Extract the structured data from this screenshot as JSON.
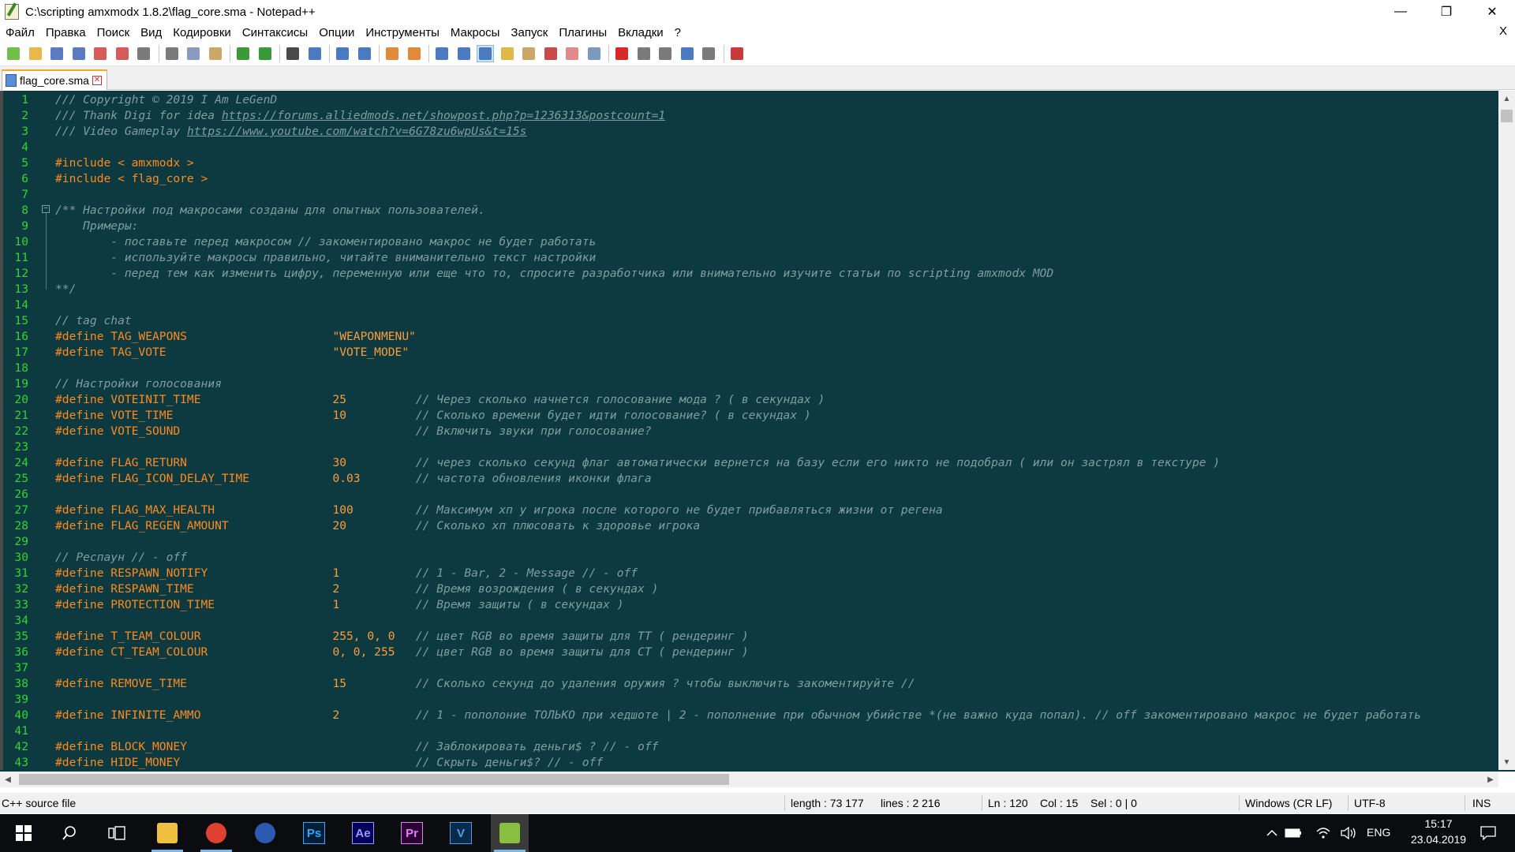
{
  "window": {
    "title": "C:\\scripting amxmodx 1.8.2\\flag_core.sma - Notepad++",
    "controls": {
      "minimize": "—",
      "maximize": "❐",
      "close": "✕"
    }
  },
  "menu": {
    "items": [
      "Файл",
      "Правка",
      "Поиск",
      "Вид",
      "Кодировки",
      "Синтаксисы",
      "Опции",
      "Инструменты",
      "Макросы",
      "Запуск",
      "Плагины",
      "Вкладки",
      "?"
    ],
    "close_doc": "X"
  },
  "toolbar": {
    "buttons": [
      {
        "icon": "new-file-icon",
        "color": "#6fbf4a"
      },
      {
        "icon": "open-file-icon",
        "color": "#e8b84a"
      },
      {
        "icon": "save-icon",
        "color": "#5a7bbf"
      },
      {
        "icon": "save-all-icon",
        "color": "#5a7bbf"
      },
      {
        "icon": "close-file-icon",
        "color": "#d65c5c"
      },
      {
        "icon": "close-all-icon",
        "color": "#d65c5c"
      },
      {
        "icon": "print-icon",
        "color": "#7a7a7a"
      },
      {
        "sep": true
      },
      {
        "icon": "cut-icon",
        "color": "#7a7a7a"
      },
      {
        "icon": "copy-icon",
        "color": "#8a9bbf"
      },
      {
        "icon": "paste-icon",
        "color": "#c9a86a"
      },
      {
        "sep": true
      },
      {
        "icon": "undo-icon",
        "color": "#3a9a3a"
      },
      {
        "icon": "redo-icon",
        "color": "#3a9a3a"
      },
      {
        "sep": true
      },
      {
        "icon": "find-icon",
        "color": "#4a4a4a"
      },
      {
        "icon": "replace-icon",
        "color": "#4a7abf"
      },
      {
        "sep": true
      },
      {
        "icon": "zoom-in-icon",
        "color": "#4a7abf"
      },
      {
        "icon": "zoom-out-icon",
        "color": "#4a7abf"
      },
      {
        "sep": true
      },
      {
        "icon": "sync-vertical-icon",
        "color": "#e08a3a"
      },
      {
        "icon": "sync-horizontal-icon",
        "color": "#e08a3a"
      },
      {
        "sep": true
      },
      {
        "icon": "word-wrap-icon",
        "color": "#4a7abf"
      },
      {
        "icon": "show-all-chars-icon",
        "color": "#4a7abf"
      },
      {
        "icon": "indent-guide-icon",
        "color": "#4a7abf",
        "active": true
      },
      {
        "icon": "udl-icon",
        "color": "#e0b84a"
      },
      {
        "icon": "doc-map-icon",
        "color": "#c9a86a"
      },
      {
        "icon": "function-list-icon",
        "color": "#c94a4a"
      },
      {
        "icon": "folder-as-workspace-icon",
        "color": "#e08a8a"
      },
      {
        "icon": "monitoring-icon",
        "color": "#7a9abf"
      },
      {
        "sep": true
      },
      {
        "icon": "record-macro-icon",
        "color": "#d62a2a"
      },
      {
        "icon": "stop-record-icon",
        "color": "#7a7a7a"
      },
      {
        "icon": "play-macro-icon",
        "color": "#7a7a7a"
      },
      {
        "icon": "run-macro-multiple-icon",
        "color": "#4a7abf"
      },
      {
        "icon": "save-macro-icon",
        "color": "#7a7a7a"
      },
      {
        "sep": true
      },
      {
        "icon": "spell-check-icon",
        "color": "#c93a3a"
      }
    ]
  },
  "tabs": [
    {
      "label": "flag_core.sma"
    }
  ],
  "editor": {
    "lines": [
      [
        {
          "t": "/// Copyright © 2019 I Am LeGenD",
          "c": "comment"
        }
      ],
      [
        {
          "t": "/// Thank Digi for idea ",
          "c": "comment"
        },
        {
          "t": "https://forums.alliedmods.net/showpost.php?p=1236313&postcount=1",
          "c": "url"
        }
      ],
      [
        {
          "t": "/// Video Gameplay ",
          "c": "comment"
        },
        {
          "t": "https://www.youtube.com/watch?v=6G78zu6wpUs&t=15s",
          "c": "url"
        }
      ],
      [],
      [
        {
          "t": "#include < amxmodx >",
          "c": "pre"
        }
      ],
      [
        {
          "t": "#include < flag_core >",
          "c": "pre"
        }
      ],
      [],
      [
        {
          "t": "/** Настройки под макросами созданы для опытных пользователей.",
          "c": "comment"
        }
      ],
      [
        {
          "t": "    Примеры:",
          "c": "comment"
        }
      ],
      [
        {
          "t": "        - поставьте перед макросом // закоментировано макрос не будет работать",
          "c": "comment"
        }
      ],
      [
        {
          "t": "        - используйте макросы правильно, читайте вниманительно текст настройки",
          "c": "comment"
        }
      ],
      [
        {
          "t": "        - перед тем как изменить цифру, переменную или еще что то, спросите разработчика или внимательно изучите статьи по scripting amxmodx MOD",
          "c": "comment"
        }
      ],
      [
        {
          "t": "**/",
          "c": "comment"
        }
      ],
      [],
      [
        {
          "t": "// tag chat",
          "c": "comment"
        }
      ],
      [
        {
          "t": "#define TAG_WEAPONS                     ",
          "c": "pre"
        },
        {
          "t": "\"WEAPONMENU\"",
          "c": "str"
        }
      ],
      [
        {
          "t": "#define TAG_VOTE                        ",
          "c": "pre"
        },
        {
          "t": "\"VOTE_MODE\"",
          "c": "str"
        }
      ],
      [],
      [
        {
          "t": "// Настройки голосования",
          "c": "comment"
        }
      ],
      [
        {
          "t": "#define VOTEINIT_TIME                   ",
          "c": "pre"
        },
        {
          "t": "25          ",
          "c": "num"
        },
        {
          "t": "// Через сколько начнется голосование мода ? ( в секундах )",
          "c": "comment"
        }
      ],
      [
        {
          "t": "#define VOTE_TIME                       ",
          "c": "pre"
        },
        {
          "t": "10          ",
          "c": "num"
        },
        {
          "t": "// Сколько времени будет идти голосование? ( в секундах )",
          "c": "comment"
        }
      ],
      [
        {
          "t": "#define VOTE_SOUND                                  ",
          "c": "pre"
        },
        {
          "t": "// Включить звуки при голосование?",
          "c": "comment"
        }
      ],
      [],
      [
        {
          "t": "#define FLAG_RETURN                     ",
          "c": "pre"
        },
        {
          "t": "30          ",
          "c": "num"
        },
        {
          "t": "// через сколько секунд флаг автоматически вернется на базу если его никто не подобрал ( или он застрял в текстуре )",
          "c": "comment"
        }
      ],
      [
        {
          "t": "#define FLAG_ICON_DELAY_TIME            ",
          "c": "pre"
        },
        {
          "t": "0.03        ",
          "c": "num"
        },
        {
          "t": "// частота обновления иконки флага",
          "c": "comment"
        }
      ],
      [],
      [
        {
          "t": "#define FLAG_MAX_HEALTH                 ",
          "c": "pre"
        },
        {
          "t": "100         ",
          "c": "num"
        },
        {
          "t": "// Максимум хп у игрока после которого не будет прибавляться жизни от регена",
          "c": "comment"
        }
      ],
      [
        {
          "t": "#define FLAG_REGEN_AMOUNT               ",
          "c": "pre"
        },
        {
          "t": "20          ",
          "c": "num"
        },
        {
          "t": "// Сколько хп плюсовать к здоровье игрока",
          "c": "comment"
        }
      ],
      [],
      [
        {
          "t": "// Респаун // - off",
          "c": "comment"
        }
      ],
      [
        {
          "t": "#define RESPAWN_NOTIFY                  ",
          "c": "pre"
        },
        {
          "t": "1           ",
          "c": "num"
        },
        {
          "t": "// 1 - Bar, 2 - Message // - off",
          "c": "comment"
        }
      ],
      [
        {
          "t": "#define RESPAWN_TIME                    ",
          "c": "pre"
        },
        {
          "t": "2           ",
          "c": "num"
        },
        {
          "t": "// Время возрождения ( в секундах )",
          "c": "comment"
        }
      ],
      [
        {
          "t": "#define PROTECTION_TIME                 ",
          "c": "pre"
        },
        {
          "t": "1           ",
          "c": "num"
        },
        {
          "t": "// Время защиты ( в секундах )",
          "c": "comment"
        }
      ],
      [],
      [
        {
          "t": "#define T_TEAM_COLOUR                   ",
          "c": "pre"
        },
        {
          "t": "255, 0, 0   ",
          "c": "num"
        },
        {
          "t": "// цвет RGB во время защиты для ТТ ( рендеринг )",
          "c": "comment"
        }
      ],
      [
        {
          "t": "#define CT_TEAM_COLOUR                  ",
          "c": "pre"
        },
        {
          "t": "0, 0, 255   ",
          "c": "num"
        },
        {
          "t": "// цвет RGB во время защиты для CT ( рендеринг )",
          "c": "comment"
        }
      ],
      [],
      [
        {
          "t": "#define REMOVE_TIME                     ",
          "c": "pre"
        },
        {
          "t": "15          ",
          "c": "num"
        },
        {
          "t": "// Сколько секунд до удаления оружия ? чтобы выключить закоментируйте //",
          "c": "comment"
        }
      ],
      [],
      [
        {
          "t": "#define INFINITE_AMMO                   ",
          "c": "pre"
        },
        {
          "t": "2           ",
          "c": "num"
        },
        {
          "t": "// 1 - пополоние ТОЛЬКО при хедшоте | 2 - пополнение при обычном убийстве *(не важно куда попал). // off закоментировано макрос не будет работать",
          "c": "comment"
        }
      ],
      [],
      [
        {
          "t": "#define BLOCK_MONEY                                 ",
          "c": "pre"
        },
        {
          "t": "// Заблокировать деньги$ ? // - off",
          "c": "comment"
        }
      ],
      [
        {
          "t": "#define HIDE_MONEY                                  ",
          "c": "pre"
        },
        {
          "t": "// Скрыть деньги$? // - off",
          "c": "comment"
        }
      ]
    ]
  },
  "statusbar": {
    "language": "C++ source file",
    "length": "length : 73 177",
    "lines": "lines : 2 216",
    "ln": "Ln : 120",
    "col": "Col : 15",
    "sel": "Sel : 0 | 0",
    "eol": "Windows (CR LF)",
    "encoding": "UTF-8",
    "mode": "INS"
  },
  "taskbar": {
    "apps": [
      {
        "icon": "file-explorer-icon",
        "color": "#f0c040"
      },
      {
        "icon": "chrome-icon",
        "color": "#e04030"
      },
      {
        "icon": "cinema4d-icon",
        "color": "#2a5ab0"
      },
      {
        "icon": "photoshop-icon",
        "label": "Ps",
        "color": "#31a8ff",
        "bg": "#001e36"
      },
      {
        "icon": "after-effects-icon",
        "label": "Ae",
        "color": "#9999ff",
        "bg": "#00005b"
      },
      {
        "icon": "premiere-icon",
        "label": "Pr",
        "color": "#ea77ff",
        "bg": "#2a0033"
      },
      {
        "icon": "vegas-icon",
        "label": "V",
        "color": "#4aa0e8",
        "bg": "#0a2a4a"
      },
      {
        "icon": "notepadpp-icon",
        "color": "#8ac040"
      }
    ],
    "tray": {
      "lang": "ENG",
      "time": "15:17",
      "date": "23.04.2019"
    }
  }
}
